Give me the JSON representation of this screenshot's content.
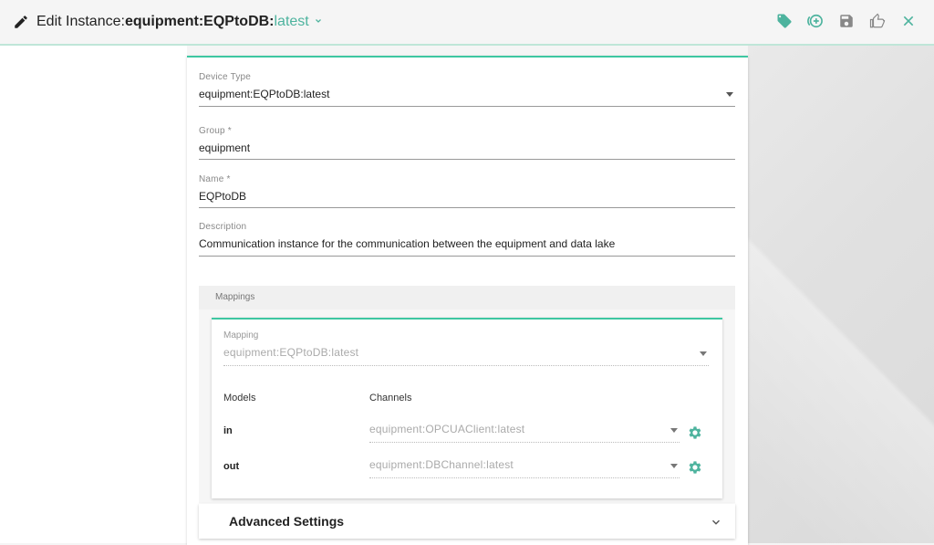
{
  "header": {
    "title_prefix": "Edit Instance:",
    "title_name": "equipment:EQPtoDB:",
    "title_version": "latest",
    "icons": [
      "tag-icon",
      "add-circle-icon",
      "save-icon",
      "thumb-up-icon",
      "close-icon"
    ],
    "accent_color": "#4db39e"
  },
  "form": {
    "device_type": {
      "label": "Device Type",
      "value": "equipment:EQPtoDB:latest"
    },
    "group": {
      "label": "Group *",
      "value": "equipment"
    },
    "name": {
      "label": "Name *",
      "value": "EQPtoDB"
    },
    "description": {
      "label": "Description",
      "value": "Communication instance for the communication between the equipment and data lake"
    }
  },
  "mappings": {
    "section_label": "Mappings",
    "mapping": {
      "label": "Mapping",
      "value": "equipment:EQPtoDB:latest"
    },
    "columns": {
      "models": "Models",
      "channels": "Channels"
    },
    "rows": [
      {
        "model": "in",
        "channel": "equipment:OPCUAClient:latest"
      },
      {
        "model": "out",
        "channel": "equipment:DBChannel:latest"
      }
    ]
  },
  "advanced": {
    "label": "Advanced Settings"
  }
}
